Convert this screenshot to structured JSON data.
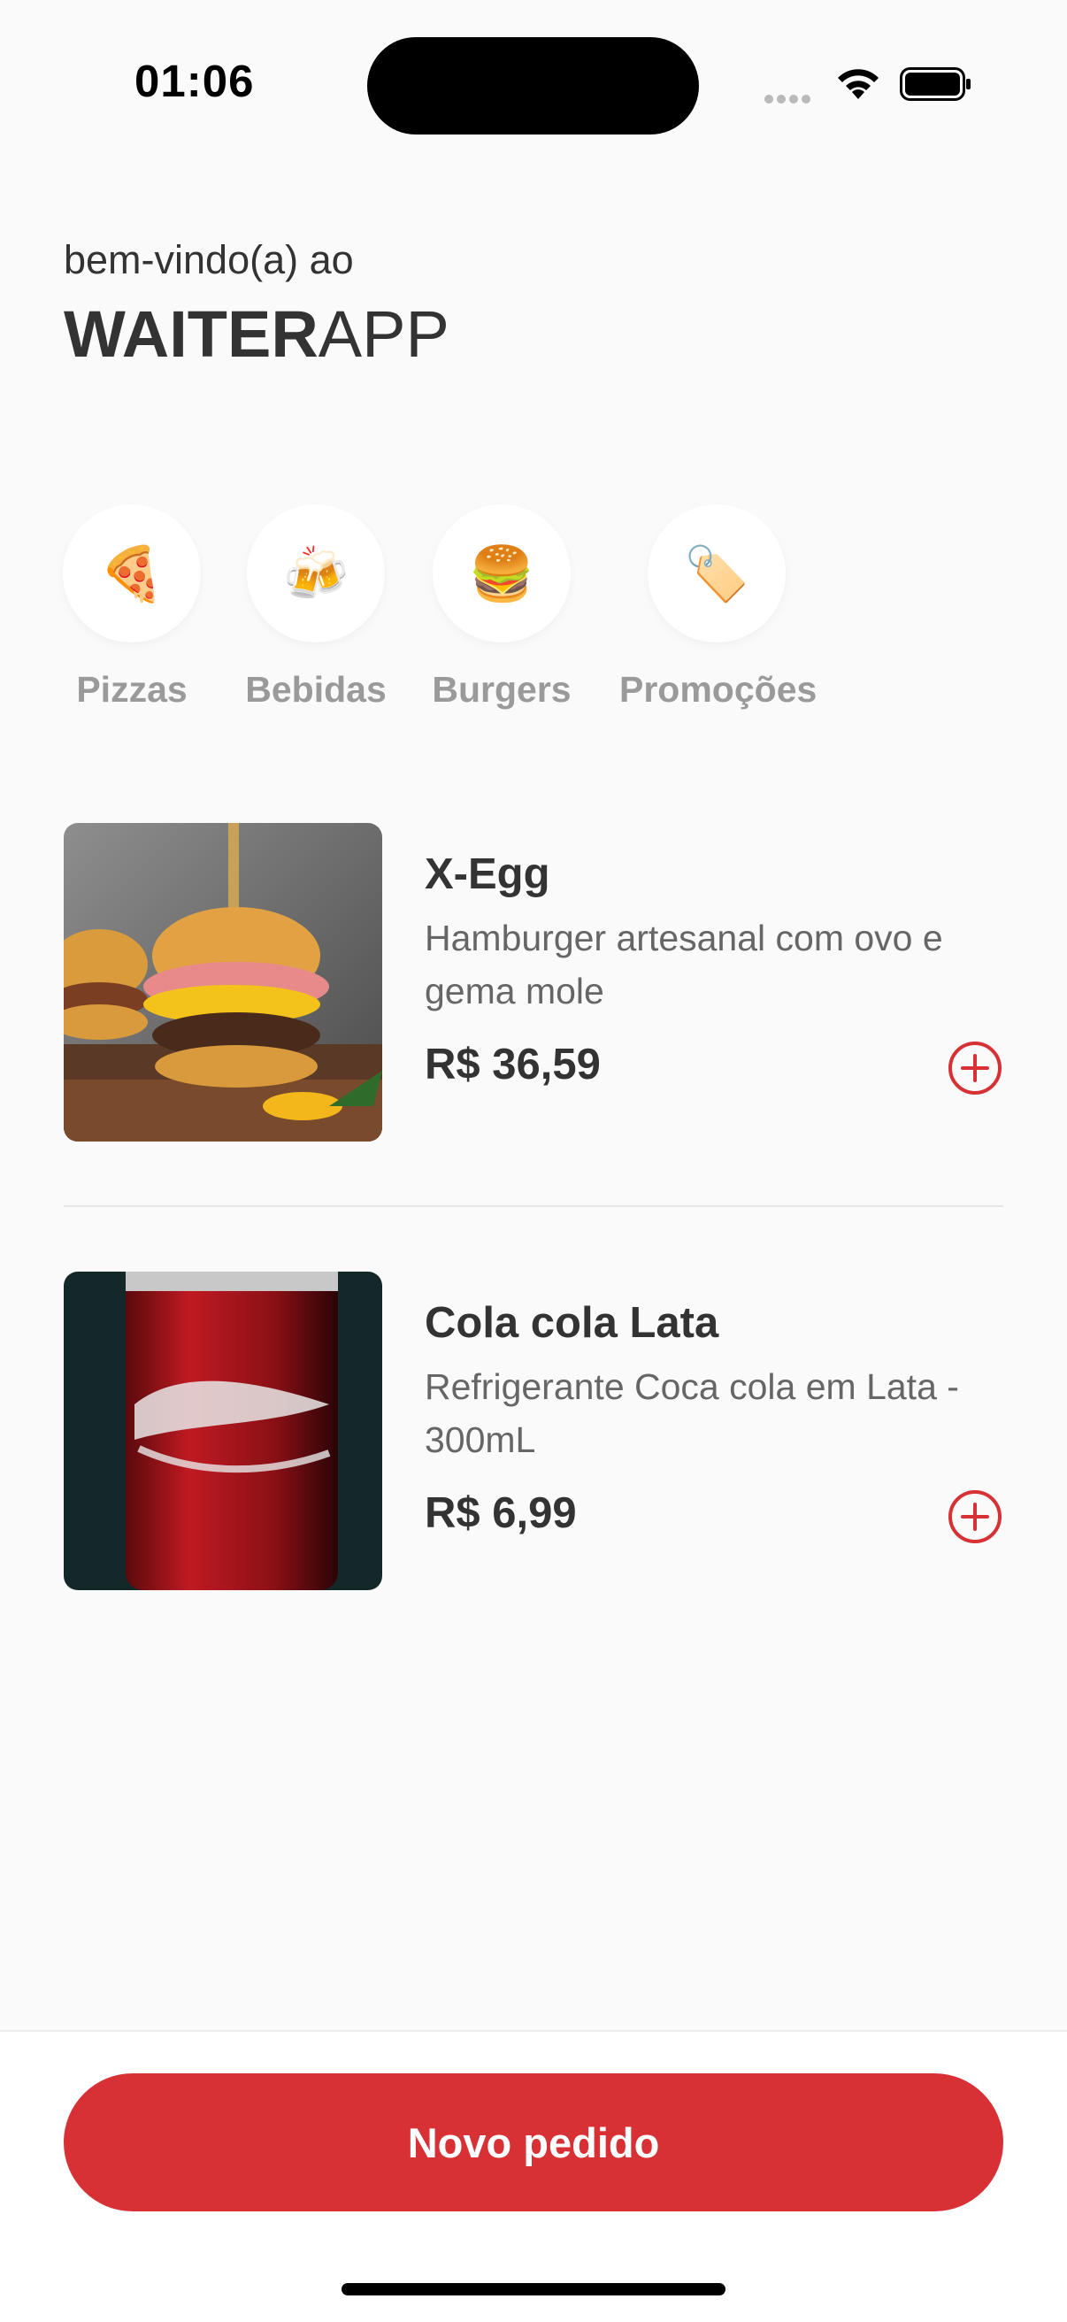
{
  "status_bar": {
    "time": "01:06"
  },
  "header": {
    "welcome": "bem-vindo(a) ao",
    "brand_bold": "WAITER",
    "brand_light": "APP"
  },
  "categories": [
    {
      "emoji": "🍕",
      "label": "Pizzas"
    },
    {
      "emoji": "🍻",
      "label": "Bebidas"
    },
    {
      "emoji": "🍔",
      "label": "Burgers"
    },
    {
      "emoji": "🏷️",
      "label": "Promoções"
    }
  ],
  "products": [
    {
      "name": "X-Egg",
      "description": "Hamburger artesanal com ovo e gema mole",
      "price": "R$ 36,59"
    },
    {
      "name": "Cola cola Lata",
      "description": "Refrigerante Coca cola em Lata - 300mL",
      "price": "R$ 6,99"
    }
  ],
  "footer": {
    "new_order_label": "Novo pedido"
  },
  "colors": {
    "accent": "#d73035",
    "background": "#fafafa",
    "text": "#333333",
    "muted": "#666666"
  }
}
